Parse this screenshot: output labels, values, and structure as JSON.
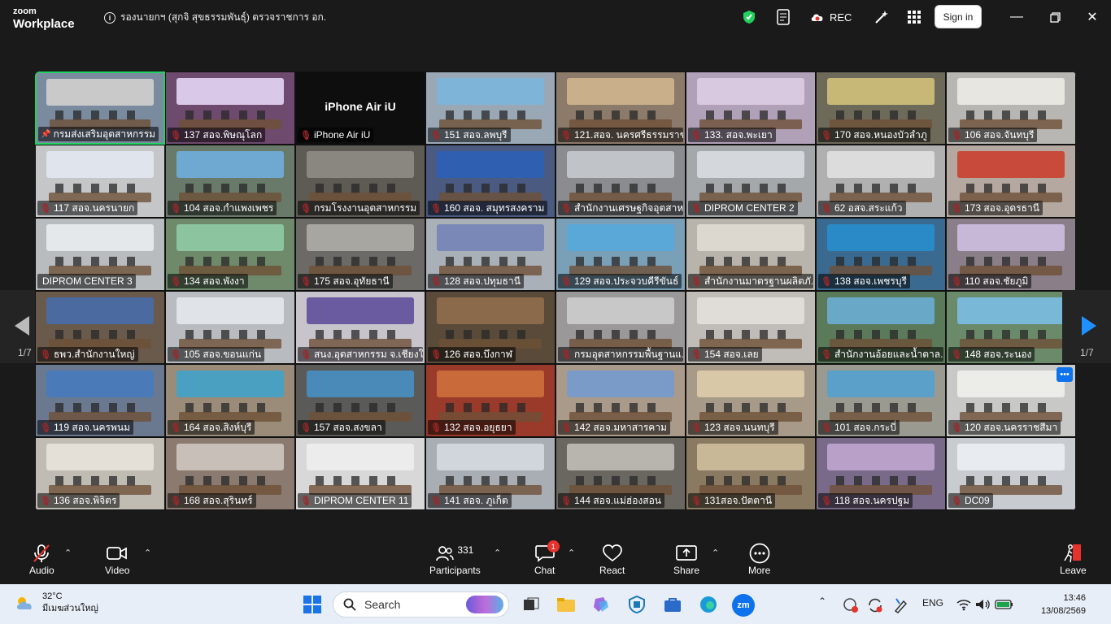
{
  "app": {
    "logo_line1": "zoom",
    "logo_line2": "Workplace"
  },
  "meeting": {
    "info_text": "รองนายกฯ (สุกจิ สุขธรรมพันธุ์) ตรวจราชการ อก."
  },
  "titlebar": {
    "rec_label": "REC",
    "signin_label": "Sign in"
  },
  "pager": {
    "left_page": "1/7",
    "right_page": "1/7"
  },
  "tiles": [
    {
      "name": "กรมส่งเสริมอุตสาหกรรม",
      "bg": "#7a8ba0",
      "banner": "#c9c9c9",
      "muted": false,
      "active": true
    },
    {
      "name": "137 สอจ.พิษณุโลก",
      "bg": "#6e4a6e",
      "banner": "#d9c8e8",
      "muted": true
    },
    {
      "name": "iPhone Air iU",
      "bg": "#0e0e0e",
      "banner": "",
      "muted": true,
      "center": "iPhone Air iU"
    },
    {
      "name": "151 สอจ.ลพบุรี",
      "bg": "#9aa8b6",
      "banner": "#7fb4d9",
      "muted": true
    },
    {
      "name": "121.สอจ. นครศรีธรรมราช",
      "bg": "#8c7a6a",
      "banner": "#c9b08a",
      "muted": true
    },
    {
      "name": "133. สอจ.พะเยา",
      "bg": "#b0a0b8",
      "banner": "#d8c8e0",
      "muted": true
    },
    {
      "name": "170 สอจ.หนองบัวลำภู",
      "bg": "#6d6a5a",
      "banner": "#c8b878",
      "muted": true
    },
    {
      "name": "106 สอจ.จันทบุรี",
      "bg": "#b8b6b2",
      "banner": "#e8e6e0",
      "muted": true
    },
    {
      "name": "117 สอจ.นครนายก",
      "bg": "#c4c6c8",
      "banner": "#e0e4ec",
      "muted": true
    },
    {
      "name": "104 สอจ.กำแพงเพชร",
      "bg": "#6a7a6a",
      "banner": "#6fa8d0",
      "muted": true
    },
    {
      "name": "กรมโรงงานอุตสาหกรรม",
      "bg": "#5e5a54",
      "banner": "#8a8680",
      "muted": true
    },
    {
      "name": "160 สอจ. สมุทรสงคราม",
      "bg": "#4a5a80",
      "banner": "#2f5fb0",
      "muted": true
    },
    {
      "name": "สำนักงานเศรษฐกิจอุตสาห...",
      "bg": "#8a8c90",
      "banner": "#c0c4c8",
      "muted": true
    },
    {
      "name": "DIPROM CENTER 2",
      "bg": "#a4a8aa",
      "banner": "#d4d8dc",
      "muted": true
    },
    {
      "name": "62 อสจ.สระแก้ว",
      "bg": "#b0b0b0",
      "banner": "#dcdcdc",
      "muted": true
    },
    {
      "name": "173 สอจ.อุดรธานี",
      "bg": "#b4a8a0",
      "banner": "#c84a3a",
      "muted": true
    },
    {
      "name": "DIPROM CENTER 3",
      "bg": "#b8bcbe",
      "banner": "#e4e8ea",
      "muted": false
    },
    {
      "name": "134 สอจ.พังงา",
      "bg": "#6e8a6a",
      "banner": "#8cc4a0",
      "muted": true
    },
    {
      "name": "175 สอจ.อุทัยธานี",
      "bg": "#6c6a66",
      "banner": "#a8a6a0",
      "muted": true
    },
    {
      "name": "128 สอจ.ปทุมธานี",
      "bg": "#aab0b8",
      "banner": "#7a88b8",
      "muted": true
    },
    {
      "name": "129 สอจ.ประจวบคีรีขันธ์",
      "bg": "#7aa0b8",
      "banner": "#5aa8d8",
      "muted": true
    },
    {
      "name": "สำนักงานมาตรฐานผลิตภั...",
      "bg": "#b8b4ac",
      "banner": "#dcd8d0",
      "muted": true
    },
    {
      "name": "138 สอจ.เพชรบุรี",
      "bg": "#3a6a90",
      "banner": "#2a8ac8",
      "muted": true
    },
    {
      "name": "110 สอจ.ชัยภูมิ",
      "bg": "#8a7e88",
      "banner": "#c8b8d8",
      "muted": true
    },
    {
      "name": "ธพว.สำนักงานใหญ่",
      "bg": "#6a5a4c",
      "banner": "#4a6aa0",
      "muted": true
    },
    {
      "name": "105 สอจ.ขอนแก่น",
      "bg": "#b8bcc0",
      "banner": "#e0e4e8",
      "muted": true
    },
    {
      "name": "สนง.อุตสาหกรรม จ.เชียงใ...",
      "bg": "#c8c4cc",
      "banner": "#6a5aa0",
      "muted": true
    },
    {
      "name": "126 สอจ.บึงกาฬ",
      "bg": "#5a4a3a",
      "banner": "#8a6a4a",
      "muted": true
    },
    {
      "name": "กรมอุตสาหกรรมพื้นฐานแ...",
      "bg": "#9a9898",
      "banner": "#c8c8c8",
      "muted": true
    },
    {
      "name": "154 สอจ.เลย",
      "bg": "#c0bcb8",
      "banner": "#e0dcd8",
      "muted": true
    },
    {
      "name": "สำนักงานอ้อยและน้ำตาล...",
      "bg": "#5a7a5a",
      "banner": "#6aa8c8",
      "muted": true
    },
    {
      "name": "148 สอจ.ระนอง",
      "bg": "#6a8a6a",
      "banner": "#7ab8d8",
      "muted": true
    },
    {
      "name": "119 สอจ.นครพนม",
      "bg": "#6a7890",
      "banner": "#4a7ab8",
      "muted": true
    },
    {
      "name": "164 สอจ.สิงห์บุรี",
      "bg": "#9a8c78",
      "banner": "#4aa0c0",
      "muted": true
    },
    {
      "name": "157 สอจ.สงขลา",
      "bg": "#5a5a58",
      "banner": "#4a8ab8",
      "muted": true
    },
    {
      "name": "132 สอจ.อยุธยา",
      "bg": "#9a3a2a",
      "banner": "#c86a3a",
      "muted": true
    },
    {
      "name": "142 สอจ.มหาสารคาม",
      "bg": "#aa9a8a",
      "banner": "#7a9ac8",
      "muted": true
    },
    {
      "name": "123 สอจ.นนทบุรี",
      "bg": "#a89a88",
      "banner": "#d8c8a8",
      "muted": true
    },
    {
      "name": "101 สอจ.กระบี่",
      "bg": "#9a9a90",
      "banner": "#5aa0c8",
      "muted": true
    },
    {
      "name": "120 สอจ.นครราชสีมา",
      "bg": "#c8c8c6",
      "banner": "#ecece8",
      "muted": true,
      "more": true
    },
    {
      "name": "136 สอจ.พิจิตร",
      "bg": "#c0bcb4",
      "banner": "#e4e0d8",
      "muted": true
    },
    {
      "name": "168 สอจ.สุรินทร์",
      "bg": "#8a7a70",
      "banner": "#c8c0b8",
      "muted": true
    },
    {
      "name": "DIPROM CENTER 11",
      "bg": "#d8d8d8",
      "banner": "#ececec",
      "muted": true
    },
    {
      "name": "141 สอจ. ภูเก็ต",
      "bg": "#a8aeb4",
      "banner": "#d0d6dc",
      "muted": true
    },
    {
      "name": "144 สอจ.แม่ฮ่องสอน",
      "bg": "#6a6660",
      "banner": "#b8b4ae",
      "muted": true
    },
    {
      "name": "131สอจ.ปัตตานี",
      "bg": "#8a7a62",
      "banner": "#c8b898",
      "muted": true
    },
    {
      "name": "118 สอจ.นครปฐม",
      "bg": "#7a6a8a",
      "banner": "#b8a0c8",
      "muted": true
    },
    {
      "name": "DC09",
      "bg": "#c8ccd0",
      "banner": "#e8ecf0",
      "muted": true
    }
  ],
  "toolbar": {
    "audio_label": "Audio",
    "video_label": "Video",
    "participants_label": "Participants",
    "participants_count": "331",
    "chat_label": "Chat",
    "chat_badge": "1",
    "react_label": "React",
    "share_label": "Share",
    "more_label": "More",
    "leave_label": "Leave"
  },
  "taskbar": {
    "temperature": "32°C",
    "weather_desc": "มีเมฆส่วนใหญ่",
    "search_placeholder": "Search",
    "lang": "ENG",
    "time": "13:46",
    "date": "13/08/2569"
  },
  "colors": {
    "accent": "#0e72ed",
    "leave": "#e5322d",
    "active_border": "#23d160",
    "shield": "#23d160"
  }
}
